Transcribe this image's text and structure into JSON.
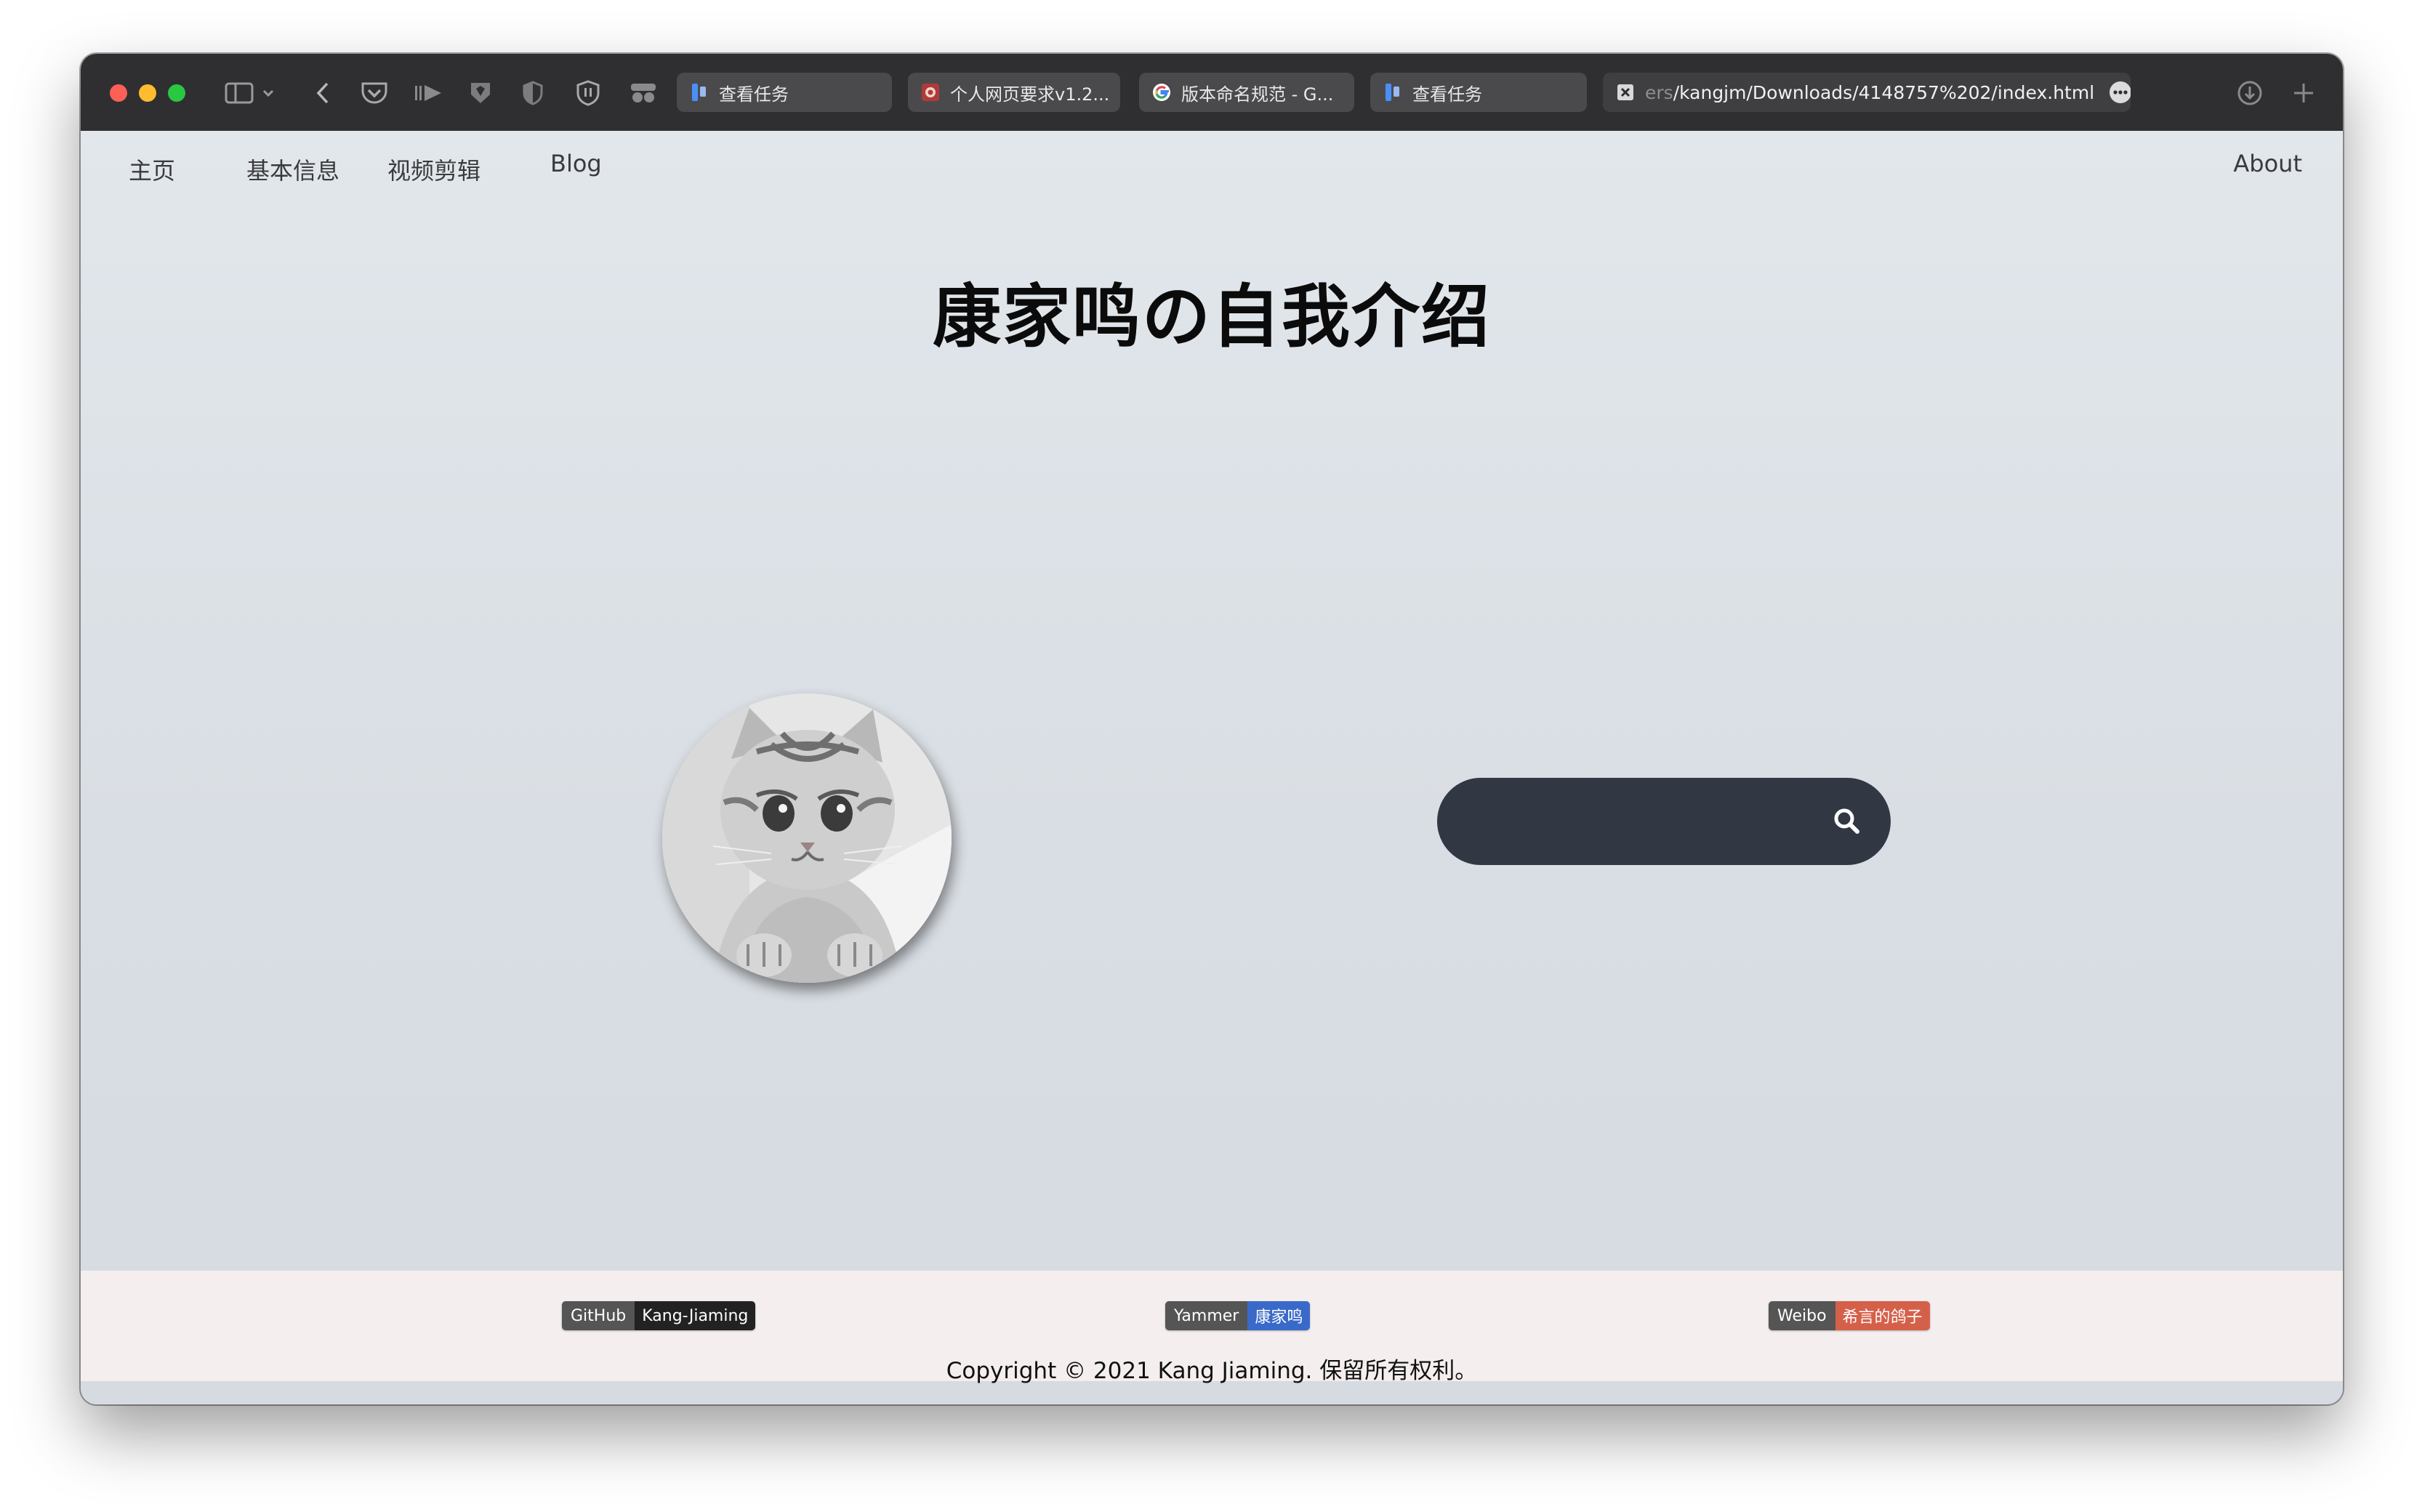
{
  "browser": {
    "tabs": [
      {
        "title": "查看任务",
        "favicon": "task-board-icon"
      },
      {
        "title": "个人网页要求v1.2...",
        "favicon": "document-red-icon"
      },
      {
        "title": "版本命名规范 - G...",
        "favicon": "google-icon"
      },
      {
        "title": "查看任务",
        "favicon": "task-board-icon"
      }
    ],
    "address_bar": {
      "prefix": "ers",
      "url": "/kangjm/Downloads/4148757%202/index.html"
    }
  },
  "nav": {
    "home": "主页",
    "basic_info": "基本信息",
    "video_editing": "视频剪辑",
    "blog": "Blog",
    "about": "About"
  },
  "main": {
    "title": "康家鸣の自我介绍",
    "search": {
      "value": "",
      "placeholder": ""
    }
  },
  "footer": {
    "badges": [
      {
        "label": "GitHub",
        "value": "Kang-Jiaming",
        "color": "#222222"
      },
      {
        "label": "Yammer",
        "value": "康家鸣",
        "color": "#396aca"
      },
      {
        "label": "Weibo",
        "value": "希言的鸽子",
        "color": "#d5604a"
      }
    ],
    "copyright": "Copyright © 2021 Kang Jiaming. 保留所有权利。"
  }
}
